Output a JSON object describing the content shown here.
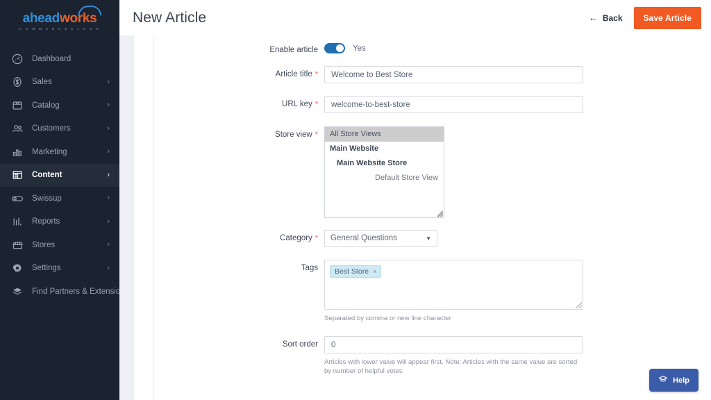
{
  "brand": {
    "name_part1": "ahead",
    "name_part2": "works",
    "tagline": "C O M M E R C E   C L O U D",
    "color_primary": "#2f8fd4",
    "color_accent": "#e8622a"
  },
  "sidebar": {
    "background": "#1b2230",
    "active_background": "#252d3d",
    "items": [
      {
        "label": "Dashboard",
        "icon": "dashboard-icon",
        "has_chevron": false,
        "active": false
      },
      {
        "label": "Sales",
        "icon": "sales-icon",
        "has_chevron": true,
        "active": false
      },
      {
        "label": "Catalog",
        "icon": "catalog-icon",
        "has_chevron": true,
        "active": false
      },
      {
        "label": "Customers",
        "icon": "customers-icon",
        "has_chevron": true,
        "active": false
      },
      {
        "label": "Marketing",
        "icon": "marketing-icon",
        "has_chevron": true,
        "active": false
      },
      {
        "label": "Content",
        "icon": "content-icon",
        "has_chevron": true,
        "active": true
      },
      {
        "label": "Swissup",
        "icon": "swissup-icon",
        "has_chevron": true,
        "active": false
      },
      {
        "label": "Reports",
        "icon": "reports-icon",
        "has_chevron": true,
        "active": false
      },
      {
        "label": "Stores",
        "icon": "stores-icon",
        "has_chevron": true,
        "active": false
      },
      {
        "label": "Settings",
        "icon": "settings-gear-icon",
        "has_chevron": true,
        "active": false
      },
      {
        "label": "Find Partners & Extensions",
        "icon": "extensions-icon",
        "has_chevron": false,
        "active": false
      }
    ],
    "chevron_glyph": "›"
  },
  "header": {
    "title": "New Article",
    "back_label": "Back",
    "back_arrow": "←",
    "save_label": "Save Article",
    "save_color": "#f15a22"
  },
  "form": {
    "enable_article": {
      "label": "Enable article",
      "value": "Yes",
      "toggle_on": true,
      "required": false
    },
    "article_title": {
      "label": "Article title",
      "value": "Welcome to Best Store",
      "placeholder": "",
      "required": true
    },
    "url_key": {
      "label": "URL key",
      "value": "welcome-to-best-store",
      "placeholder": "",
      "required": true
    },
    "store_view": {
      "label": "Store view",
      "required": true,
      "options": [
        {
          "text": "All Store Views",
          "level": 0,
          "selected": true
        },
        {
          "text": "Main Website",
          "level": 1,
          "selected": false
        },
        {
          "text": "Main Website Store",
          "level": 2,
          "selected": false
        },
        {
          "text": "Default Store View",
          "level": 3,
          "selected": false
        }
      ]
    },
    "category": {
      "label": "Category",
      "value": "General Questions",
      "required": true,
      "caret": "▼"
    },
    "tags": {
      "label": "Tags",
      "required": false,
      "chips": [
        {
          "text": "Best Store",
          "remove": "×"
        }
      ],
      "hint": "Separated by comma or new line character"
    },
    "sort_order": {
      "label": "Sort order",
      "value": "0",
      "required": false,
      "hint": "Articles with lower value will appear first. Note: Articles with the same value are sorted by number of helpful votes"
    }
  },
  "help": {
    "label": "Help",
    "icon": "graduation-cap-icon",
    "color": "#3b5ca8"
  }
}
